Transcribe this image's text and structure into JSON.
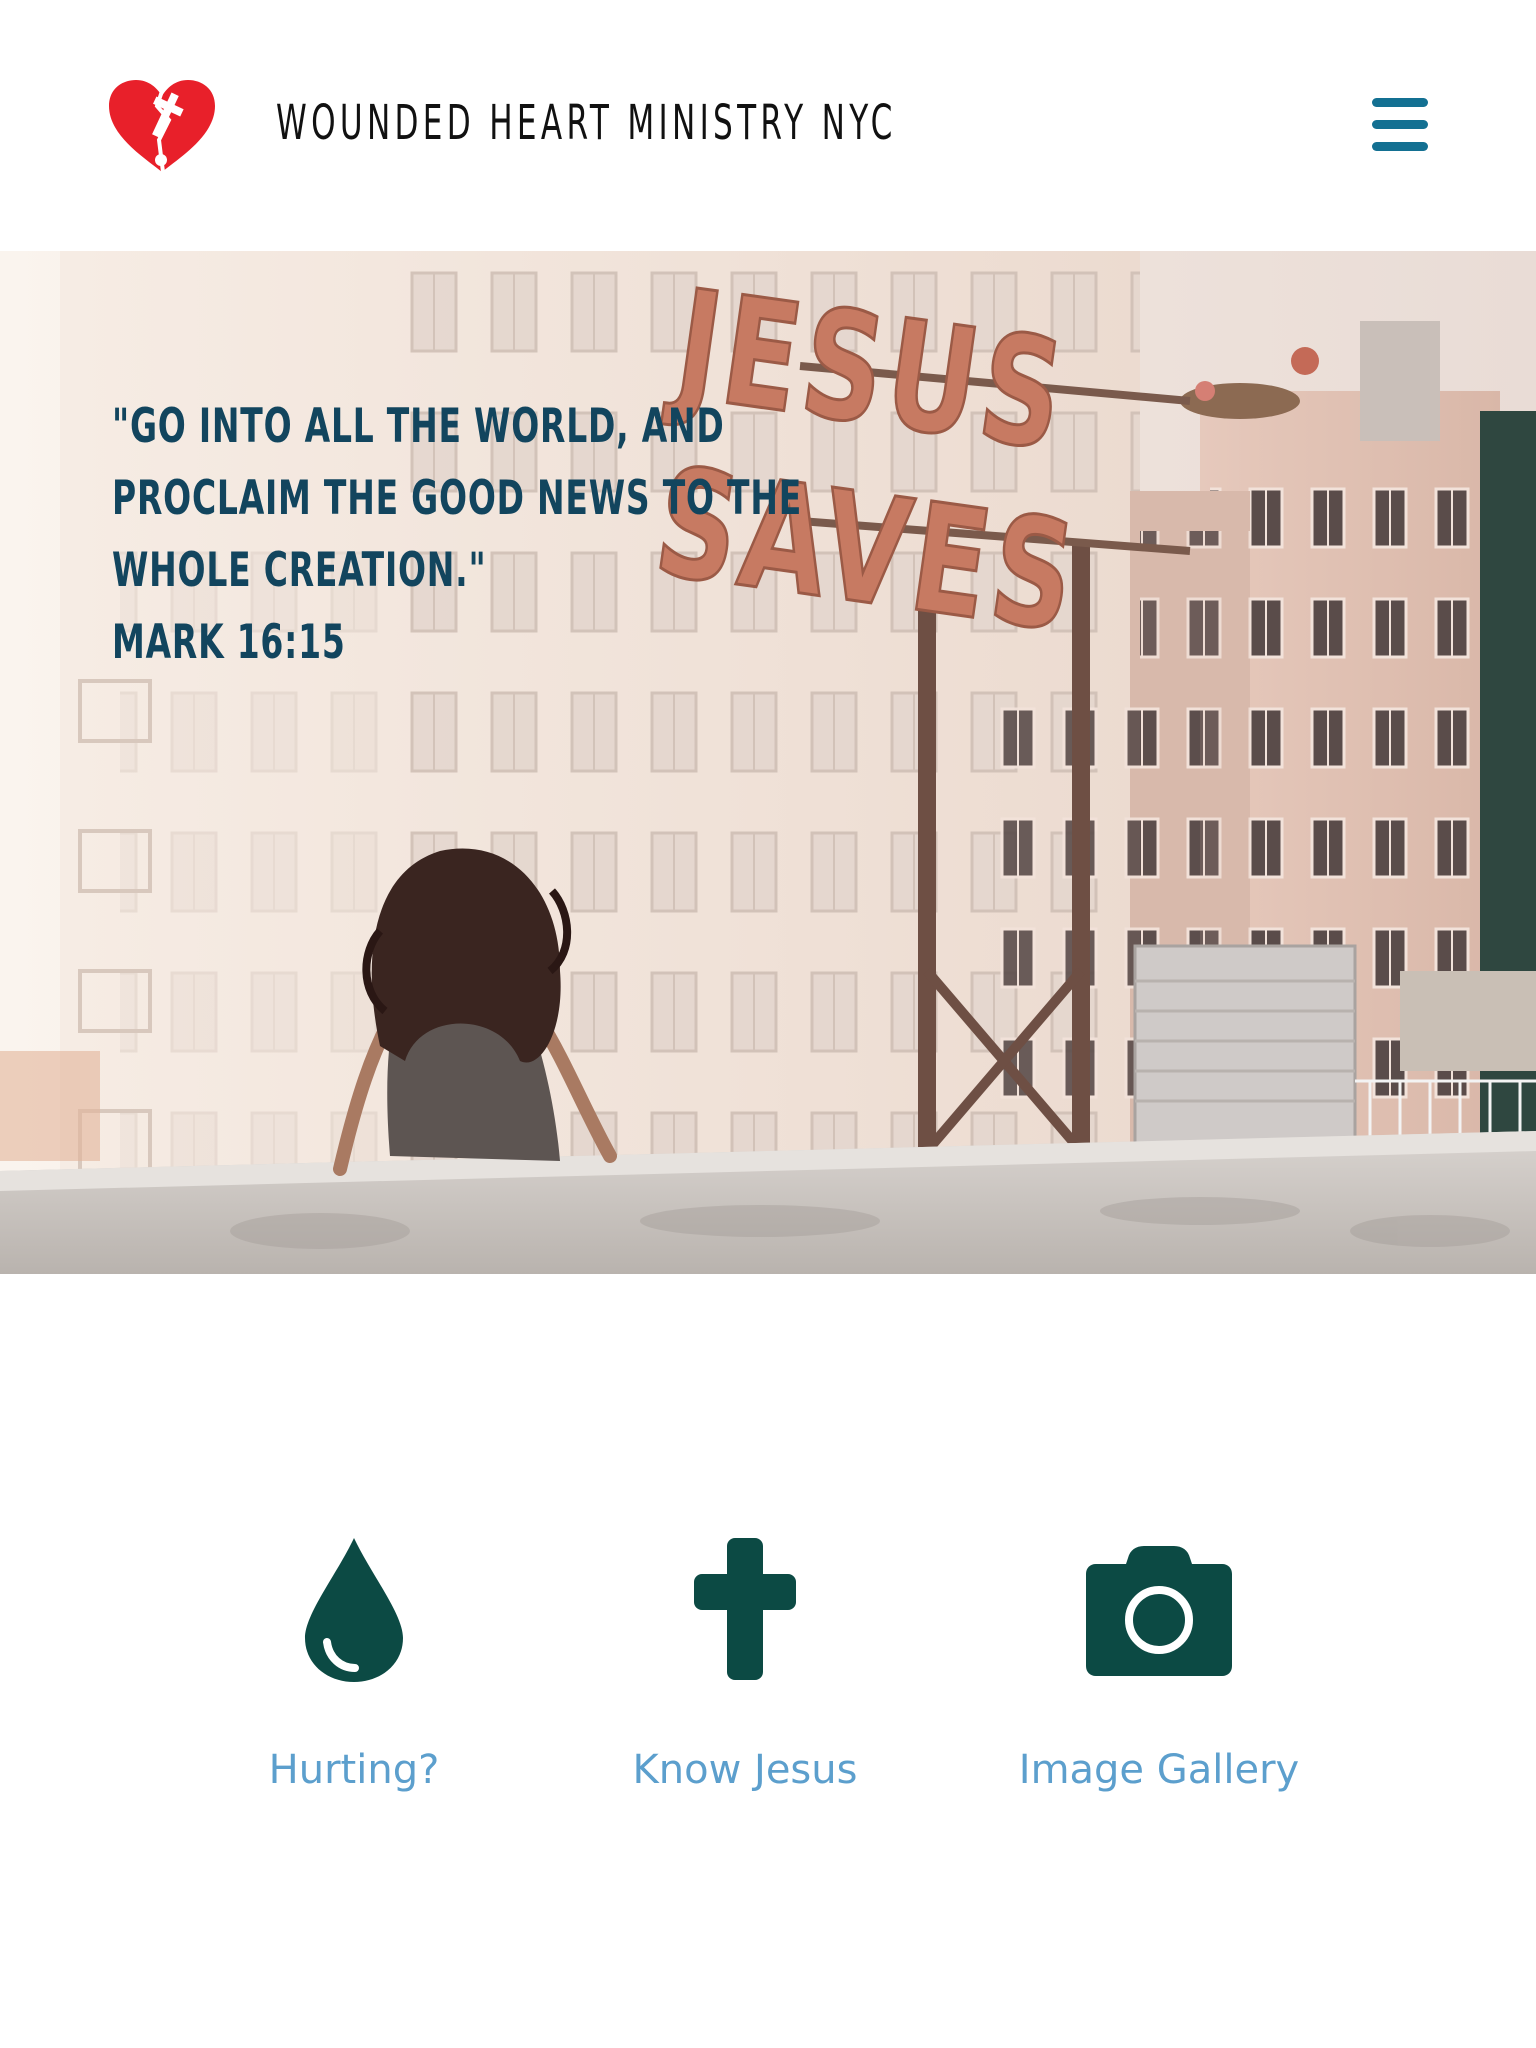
{
  "header": {
    "logo_icon": "broken-heart-cross-icon",
    "site_title": "WOUNDED HEART MINISTRY NYC",
    "menu_icon": "hamburger-menu-icon"
  },
  "hero": {
    "verse_lines": [
      "\"GO INTO ALL THE WORLD, AND",
      "PROCLAIM THE GOOD NEWS TO THE",
      "WHOLE CREATION.\"",
      "MARK 16:15"
    ],
    "sign_text_top": "JESUS",
    "sign_text_bottom": "SAVES"
  },
  "features": [
    {
      "label": "Hurting?",
      "icon": "water-drop-icon"
    },
    {
      "label": "Know Jesus",
      "icon": "cross-icon"
    },
    {
      "label": "Image Gallery",
      "icon": "camera-icon"
    }
  ],
  "colors": {
    "brand_blue": "#137092",
    "verse_text": "#12455e",
    "icon_green": "#0c4a44",
    "link_blue": "#5c9fcd",
    "logo_red": "#e8202a"
  }
}
